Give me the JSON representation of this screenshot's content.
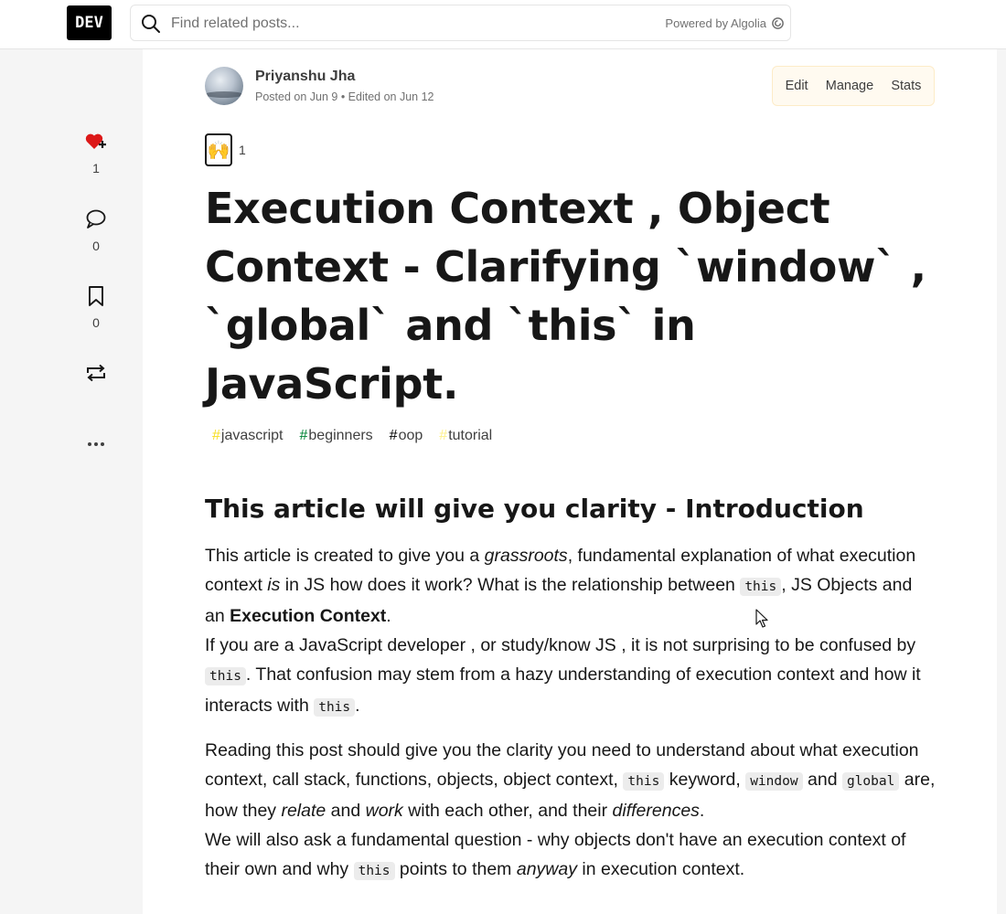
{
  "header": {
    "logo": "DEV",
    "search_placeholder": "Find related posts...",
    "powered_by": "Powered by Algolia"
  },
  "sidebar": {
    "like_count": "1",
    "comment_count": "0",
    "bookmark_count": "0"
  },
  "article": {
    "author_name": "Priyanshu Jha",
    "posted": "Posted on Jun 9 • Edited on Jun 12",
    "actions": {
      "edit": "Edit",
      "manage": "Manage",
      "stats": "Stats"
    },
    "reaction_emoji": "🙌",
    "reaction_count": "1",
    "title": "Execution Context , Object Context - Clarifying `window` , `global` and `this` in JavaScript.",
    "tags": [
      {
        "name": "javascript",
        "color": "#f7df1e"
      },
      {
        "name": "beginners",
        "color": "#008335"
      },
      {
        "name": "oop",
        "color": "#000000"
      },
      {
        "name": "tutorial",
        "color": "#fef08a"
      }
    ],
    "heading": "This article will give you clarity - Introduction",
    "p1": {
      "s1": "This article is created to give you a ",
      "em1": "grassroots",
      "s2": ", fundamental explanation of what execution context ",
      "em2": "is",
      "s3": " in JS how does it work? What is the relationship between ",
      "code1": "this",
      "s4": ", JS Objects and an ",
      "strong": "Execution Context",
      "s5": ".",
      "s6": "If you are a JavaScript developer , or study/know JS , it is not surprising to be confused by ",
      "code2": "this",
      "s7": ". That confusion may stem from a hazy understanding of execution context and how it interacts with ",
      "code3": "this",
      "s8": "."
    },
    "p2": {
      "s1": "Reading this post should give you the clarity you need to understand about what execution context, call stack, functions, objects, object context, ",
      "code1": "this",
      "s2": " keyword, ",
      "code2": "window",
      "s3": " and ",
      "code3": "global",
      "s4": " are, how they ",
      "em1": "relate",
      "s5": " and ",
      "em2": "work",
      "s6": " with each other, and their ",
      "em3": "differences",
      "s7": ".",
      "s8": "We will also ask a fundamental question - why objects don't have an execution context of their own and why ",
      "code4": "this",
      "s9": " points to them ",
      "em4": "anyway",
      "s10": " in execution context."
    }
  },
  "colors": {
    "heart": "#dc1818",
    "owner_bg": "#fffaf0"
  }
}
